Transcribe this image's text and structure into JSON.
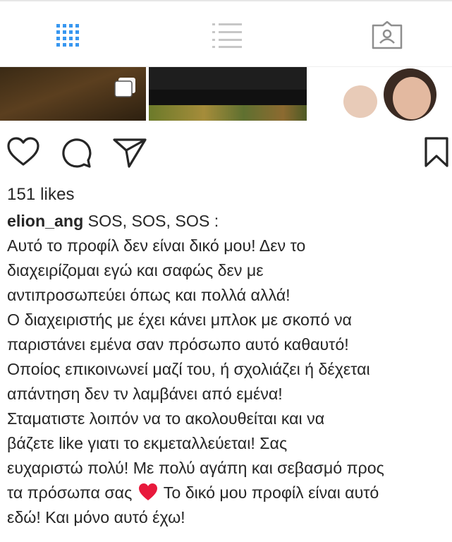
{
  "tabs": [
    {
      "name": "grid-icon",
      "active": true,
      "color": "#3897f0"
    },
    {
      "name": "list-icon",
      "active": false,
      "color": "#c7c7c7"
    },
    {
      "name": "tagged-icon",
      "active": false,
      "color": "#8e8e8e"
    }
  ],
  "post": {
    "likes": "151 likes",
    "username": "elion_ang",
    "caption_first": " SOS, SOS, SOS :",
    "caption_lines": [
      "Αυτό το προφίλ δεν είναι δικό μου! Δεν το",
      "διαχειρίζομαι εγώ και σαφώς δεν  με",
      "αντιπροσωπεύει όπως και πολλά αλλά!",
      "Ο διαχειριστής με έχει κάνει μπλοκ με σκοπό να",
      "παριστάνει εμένα σαν πρόσωπο αυτό καθαυτό!",
      "Οποίος επικοινωνεί μαζί του, ή σχολιάζει ή δέχεται",
      "απάντηση δεν τν λαμβάνει από εμένα!",
      "Σταματιστε λοιπόν  να το ακολουθείται και να",
      "βάζετε like γιατι το εκμεταλλεύεται!  Σας",
      "ευχαριστώ πολύ!  Με πολύ αγάπη και σεβασμό προς"
    ],
    "caption_heart_before": "τα πρόσωπα σας",
    "caption_heart_after": " Το δικό μου προφίλ είναι αυτό",
    "caption_last": "εδώ! Και μόνο αυτό έχω!",
    "heart_color": "#e8193c"
  }
}
